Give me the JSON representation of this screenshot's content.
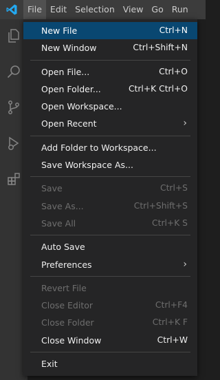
{
  "menubar": {
    "items": [
      "File",
      "Edit",
      "Selection",
      "View",
      "Go",
      "Run"
    ]
  },
  "colors": {
    "accent": "#007acc",
    "highlight": "#094771",
    "menu_bg": "#252526",
    "menubar_bg": "#3c3c3c",
    "activitybar_bg": "#333333"
  },
  "activity_icons": [
    "explorer-icon",
    "search-icon",
    "source-control-icon",
    "run-debug-icon",
    "extensions-icon"
  ],
  "file_menu": {
    "new_file": {
      "label": "New File",
      "shortcut": "Ctrl+N"
    },
    "new_window": {
      "label": "New Window",
      "shortcut": "Ctrl+Shift+N"
    },
    "open_file": {
      "label": "Open File...",
      "shortcut": "Ctrl+O"
    },
    "open_folder": {
      "label": "Open Folder...",
      "shortcut": "Ctrl+K Ctrl+O"
    },
    "open_workspace": {
      "label": "Open Workspace..."
    },
    "open_recent": {
      "label": "Open Recent",
      "submenu": "›"
    },
    "add_folder": {
      "label": "Add Folder to Workspace..."
    },
    "save_workspace_as": {
      "label": "Save Workspace As..."
    },
    "save": {
      "label": "Save",
      "shortcut": "Ctrl+S"
    },
    "save_as": {
      "label": "Save As...",
      "shortcut": "Ctrl+Shift+S"
    },
    "save_all": {
      "label": "Save All",
      "shortcut": "Ctrl+K S"
    },
    "auto_save": {
      "label": "Auto Save"
    },
    "preferences": {
      "label": "Preferences",
      "submenu": "›"
    },
    "revert_file": {
      "label": "Revert File"
    },
    "close_editor": {
      "label": "Close Editor",
      "shortcut": "Ctrl+F4"
    },
    "close_folder": {
      "label": "Close Folder",
      "shortcut": "Ctrl+K F"
    },
    "close_window": {
      "label": "Close Window",
      "shortcut": "Ctrl+W"
    },
    "exit": {
      "label": "Exit"
    }
  }
}
